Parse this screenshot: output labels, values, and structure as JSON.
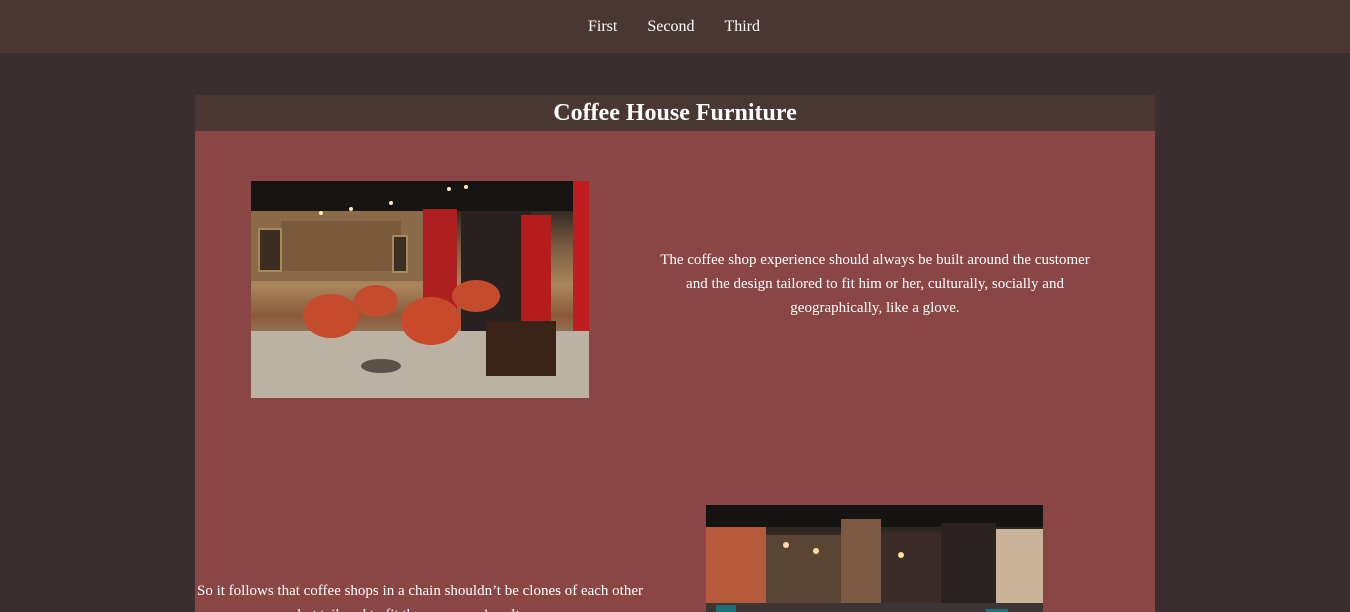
{
  "nav": {
    "items": [
      {
        "label": "First"
      },
      {
        "label": "Second"
      },
      {
        "label": "Third"
      }
    ]
  },
  "panel": {
    "title": "Coffee House Furniture",
    "paragraph1": "The coffee shop experience should always be built around the customer and the design tailored to fit him or her, culturally, socially and geographically, like a glove.",
    "paragraph2": "So it follows that coffee shops in a chain shouldn’t be clones of each other but tailored to fit the consumer’s culture."
  }
}
